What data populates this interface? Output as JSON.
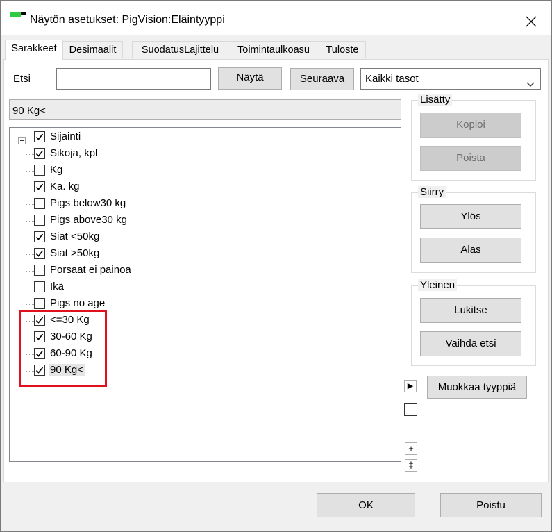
{
  "window": {
    "title": "Näytön asetukset: PigVision:Eläintyyppi",
    "close_glyph": "✕"
  },
  "tabs": [
    {
      "label": "Sarakkeet",
      "active": true
    },
    {
      "label": "Desimaalit",
      "active": false
    },
    {
      "label": "SuodatusLajittelu",
      "active": false
    },
    {
      "label": "Toimintaulkoasu",
      "active": false
    },
    {
      "label": "Tuloste",
      "active": false
    }
  ],
  "search": {
    "label": "Etsi",
    "value": "",
    "show_button": "Näytä",
    "next_button": "Seuraava",
    "level_select": "Kaikki tasot"
  },
  "selected_path": "90 Kg<",
  "tree": {
    "items": [
      {
        "label": "Sijainti",
        "checked": true,
        "expandable": true
      },
      {
        "label": "Sikoja, kpl",
        "checked": true
      },
      {
        "label": "Kg",
        "checked": false
      },
      {
        "label": "Ka. kg",
        "checked": true
      },
      {
        "label": "Pigs below30 kg",
        "checked": false
      },
      {
        "label": "Pigs above30 kg",
        "checked": false
      },
      {
        "label": "Siat <50kg",
        "checked": true
      },
      {
        "label": "Siat >50kg",
        "checked": true
      },
      {
        "label": "Porsaat ei painoa",
        "checked": false
      },
      {
        "label": "Ikä",
        "checked": false
      },
      {
        "label": "Pigs no age",
        "checked": false
      },
      {
        "label": "<=30 Kg",
        "checked": true
      },
      {
        "label": "30-60 Kg",
        "checked": true
      },
      {
        "label": "60-90 Kg",
        "checked": true
      },
      {
        "label": "90 Kg<",
        "checked": true,
        "selected": true
      }
    ]
  },
  "groups": {
    "added": {
      "title": "Lisätty",
      "copy_button": "Kopioi",
      "remove_button": "Poista"
    },
    "move": {
      "title": "Siirry",
      "up_button": "Ylös",
      "down_button": "Alas"
    },
    "general": {
      "title": "Yleinen",
      "lock_button": "Lukitse",
      "switch_search_button": "Vaihda etsi"
    }
  },
  "edit_type_button": "Muokkaa tyyppiä",
  "side_controls": {
    "arrow_glyph": "▶",
    "equal_glyph": "=",
    "plus_glyph": "+",
    "double_dagger_glyph": "‡"
  },
  "footer": {
    "ok_button": "OK",
    "cancel_button": "Poistu"
  },
  "colors": {
    "highlight_border": "#e0101c",
    "window_bg": "#f0f0f0"
  }
}
